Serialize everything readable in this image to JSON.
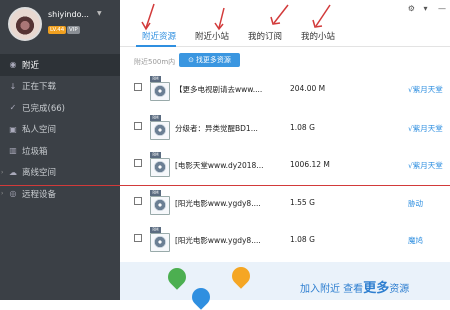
{
  "profile": {
    "username": "shiyindo...",
    "level": "LV.44",
    "vip": "VIP"
  },
  "sidebar": {
    "items": [
      {
        "label": "附近",
        "icon": "location-icon",
        "active": true
      },
      {
        "label": "正在下载",
        "icon": "download-icon"
      },
      {
        "label": "已完成(66)",
        "icon": "check-icon"
      },
      {
        "label": "私人空间",
        "icon": "lock-icon"
      },
      {
        "label": "垃圾箱",
        "icon": "trash-icon"
      },
      {
        "label": "离线空间",
        "icon": "cloud-icon",
        "expandable": true
      },
      {
        "label": "远程设备",
        "icon": "remote-icon",
        "expandable": true
      }
    ]
  },
  "tabs": [
    {
      "label": "附近资源",
      "active": true
    },
    {
      "label": "附近小站"
    },
    {
      "label": "我的订阅"
    },
    {
      "label": "我的小站"
    }
  ],
  "filter": {
    "label": "附近500m内",
    "button": "找更多资源"
  },
  "files": [
    {
      "name": "【更多电视剧请去www....",
      "size": "204.00 M",
      "link": "√紫月天堂"
    },
    {
      "name": "分级者：异类觉醒BD1...",
      "size": "1.08 G",
      "link": "√紫月天堂"
    },
    {
      "name": "[电影天堂www.dy2018...",
      "size": "1006.12 M",
      "link": "√紫月天堂"
    },
    {
      "name": "[阳光电影www.ygdy8....",
      "size": "1.55 G",
      "link": "胁动"
    },
    {
      "name": "[阳光电影www.ygdy8....",
      "size": "1.08 G",
      "link": "魔鸠"
    }
  ],
  "file_tag": "RM",
  "banner": {
    "text_a": "加入附近 查看",
    "text_big": "更多",
    "text_b": "资源"
  },
  "colors": {
    "accent": "#2f8fe0",
    "sidebar": "#3b4046",
    "annotation": "#d23a3a"
  }
}
